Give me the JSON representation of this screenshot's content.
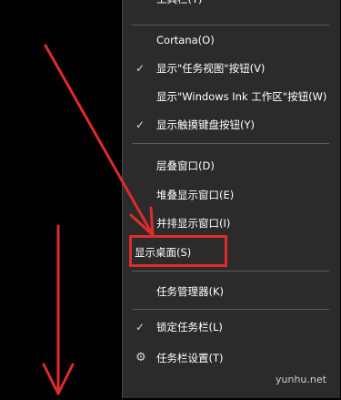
{
  "menu": {
    "items": [
      {
        "label": "工具栏(T)",
        "checked": false
      },
      {
        "label": "Cortana(O)",
        "checked": false
      },
      {
        "label": "显示\"任务视图\"按钮(V)",
        "checked": true
      },
      {
        "label": "显示\"Windows Ink 工作区\"按钮(W)",
        "checked": false
      },
      {
        "label": "显示触摸键盘按钮(Y)",
        "checked": true
      },
      {
        "label": "层叠窗口(D)",
        "checked": false
      },
      {
        "label": "堆叠显示窗口(E)",
        "checked": false
      },
      {
        "label": "并排显示窗口(I)",
        "checked": false
      },
      {
        "label": "显示桌面(S)",
        "checked": false,
        "highlighted": true
      },
      {
        "label": "任务管理器(K)",
        "checked": false
      },
      {
        "label": "锁定任务栏(L)",
        "checked": true
      },
      {
        "label": "任务栏设置(T)",
        "icon": "gear-icon"
      }
    ]
  },
  "watermark": "yunhu.net",
  "colors": {
    "menu_bg": "#2b2b2b",
    "annotation_red": "#e02b2b",
    "text": "#ffffff"
  }
}
